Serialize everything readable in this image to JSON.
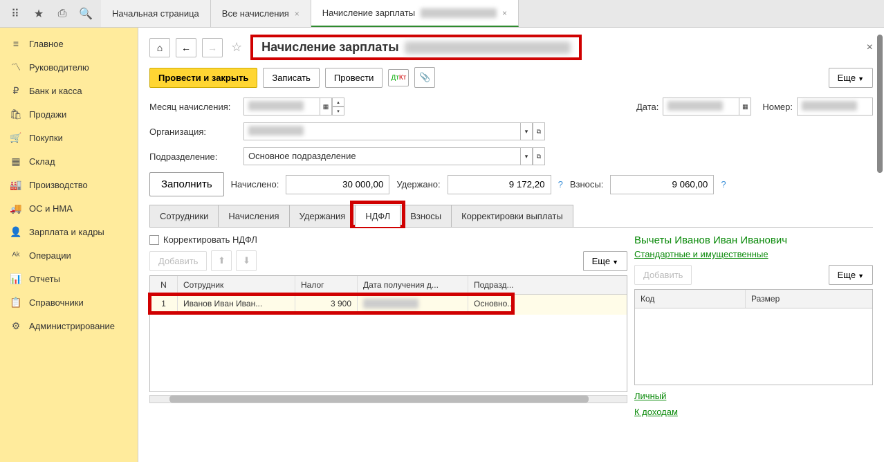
{
  "topbar": {
    "tabs": [
      {
        "label": "Начальная страница",
        "closable": false
      },
      {
        "label": "Все начисления",
        "closable": true
      },
      {
        "label": "Начисление зарплаты",
        "closable": true,
        "active": true
      }
    ]
  },
  "sidebar": {
    "items": [
      {
        "icon": "≡",
        "label": "Главное"
      },
      {
        "icon": "📈",
        "label": "Руководителю"
      },
      {
        "icon": "₽",
        "label": "Банк и касса"
      },
      {
        "icon": "🛍",
        "label": "Продажи"
      },
      {
        "icon": "🛒",
        "label": "Покупки"
      },
      {
        "icon": "▦",
        "label": "Склад"
      },
      {
        "icon": "🏭",
        "label": "Производство"
      },
      {
        "icon": "🚚",
        "label": "ОС и НМА"
      },
      {
        "icon": "👤",
        "label": "Зарплата и кадры"
      },
      {
        "icon": "ᴬᴮ",
        "label": "Операции"
      },
      {
        "icon": "📊",
        "label": "Отчеты"
      },
      {
        "icon": "📋",
        "label": "Справочники"
      },
      {
        "icon": "⚙",
        "label": "Администрирование"
      }
    ]
  },
  "page": {
    "title": "Начисление зарплаты",
    "buttons": {
      "post_close": "Провести и закрыть",
      "save": "Записать",
      "post": "Провести",
      "more": "Еще"
    },
    "fields": {
      "month_label": "Месяц начисления:",
      "date_label": "Дата:",
      "number_label": "Номер:",
      "org_label": "Организация:",
      "dept_label": "Подразделение:",
      "dept_value": "Основное подразделение"
    },
    "totals": {
      "fill": "Заполнить",
      "accrued_label": "Начислено:",
      "accrued_value": "30 000,00",
      "withheld_label": "Удержано:",
      "withheld_value": "9 172,20",
      "contrib_label": "Взносы:",
      "contrib_value": "9 060,00"
    },
    "tabs": {
      "employees": "Сотрудники",
      "accruals": "Начисления",
      "withholdings": "Удержания",
      "ndfl": "НДФЛ",
      "contrib": "Взносы",
      "corrections": "Корректировки выплаты"
    },
    "ndfl": {
      "correct_chk": "Корректировать НДФЛ",
      "add": "Добавить",
      "more": "Еще",
      "cols": {
        "n": "N",
        "emp": "Сотрудник",
        "tax": "Налог",
        "date": "Дата получения д...",
        "dept": "Подразд..."
      },
      "row": {
        "n": "1",
        "emp": "Иванов Иван Иван...",
        "tax": "3 900",
        "dept": "Основно..."
      }
    },
    "deductions": {
      "title": "Вычеты Иванов Иван Иванович",
      "std_link": "Стандартные и имущественные",
      "add": "Добавить",
      "more": "Еще",
      "cols": {
        "code": "Код",
        "size": "Размер"
      },
      "personal_link": "Личный",
      "income_link": "К доходам"
    }
  }
}
